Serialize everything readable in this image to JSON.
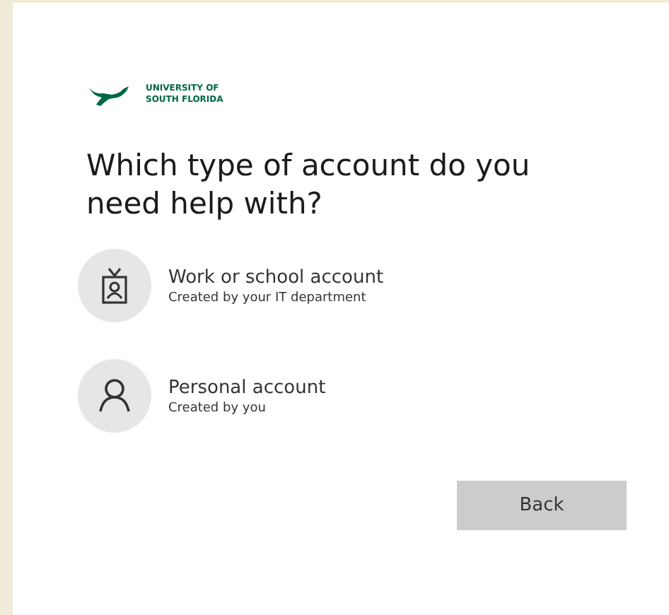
{
  "logo": {
    "lines": [
      "UNIVERSITY OF",
      "SOUTH FLORIDA"
    ]
  },
  "heading": "Which type of account do you need help with?",
  "options": [
    {
      "kind": "work",
      "title": "Work or school account",
      "subtitle": "Created by your IT department"
    },
    {
      "kind": "personal",
      "title": "Personal account",
      "subtitle": "Created by you"
    }
  ],
  "buttons": [
    "Back"
  ]
}
